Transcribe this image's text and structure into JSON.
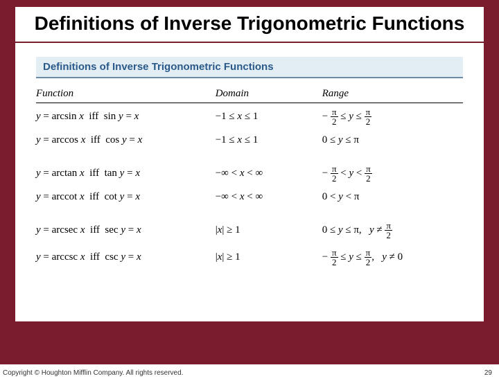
{
  "slide": {
    "title": "Definitions of Inverse Trigonometric Functions",
    "box_title": "Definitions of Inverse Trigonometric Functions",
    "headers": {
      "function": "Function",
      "domain": "Domain",
      "range": "Range"
    },
    "rows": [
      {
        "func": "y = arcsin x  iff  sin y = x",
        "domain": "−1 ≤ x ≤ 1",
        "range_type": "pi2_le",
        "range_text": "−π/2 ≤ y ≤ π/2"
      },
      {
        "func": "y = arccos x  iff  cos y = x",
        "domain": "−1 ≤ x ≤ 1",
        "range_type": "zero_pi",
        "range_text": "0 ≤ y ≤ π"
      },
      {
        "func": "y = arctan x  iff  tan y = x",
        "domain": "−∞ < x < ∞",
        "range_type": "pi2_lt",
        "range_text": "−π/2 < y < π/2"
      },
      {
        "func": "y = arccot x  iff  cot y = x",
        "domain": "−∞ < x < ∞",
        "range_type": "zero_pi_open",
        "range_text": "0 < y < π"
      },
      {
        "func": "y = arcsec x  iff  sec y = x",
        "domain": "|x| ≥ 1",
        "range_type": "sec",
        "range_text": "0 ≤ y ≤ π,  y ≠ π/2"
      },
      {
        "func": "y = arccsc x  iff  csc y = x",
        "domain": "|x| ≥ 1",
        "range_type": "csc",
        "range_text": "−π/2 ≤ y ≤ π/2,  y ≠ 0"
      }
    ]
  },
  "footer": {
    "copyright": "Copyright © Houghton Mifflin Company. All rights reserved.",
    "page": "29"
  }
}
